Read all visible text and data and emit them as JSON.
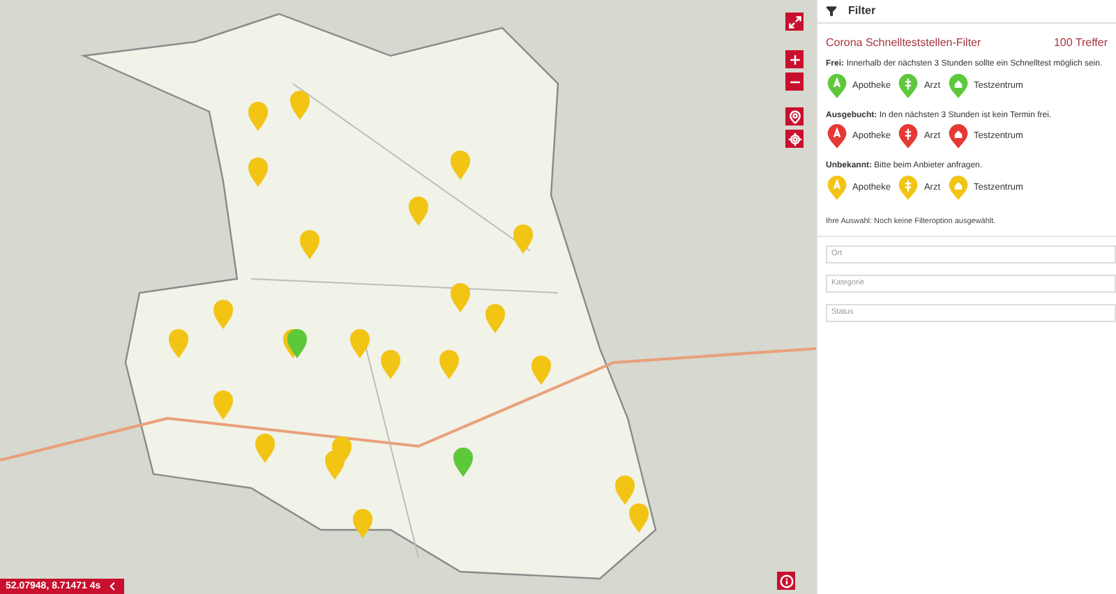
{
  "map": {
    "coordinates": "52.07948, 8.71471 4s"
  },
  "panel": {
    "header": "Filter",
    "title": "Corona Schnellteststellen-Filter",
    "count": "100 Treffer",
    "legend": [
      {
        "label": "Frei:",
        "text": "Innerhalb der nächsten 3 Stunden sollte ein Schnelltest möglich sein.",
        "color": "#5cc83a",
        "items": [
          {
            "kind": "pharmacy",
            "label": "Apotheke"
          },
          {
            "kind": "doctor",
            "label": "Arzt"
          },
          {
            "kind": "center",
            "label": "Testzentrum"
          }
        ]
      },
      {
        "label": "Ausgebucht:",
        "text": "In den nächsten 3 Stunden ist kein Termin frei.",
        "color": "#e53935",
        "items": [
          {
            "kind": "pharmacy",
            "label": "Apotheke"
          },
          {
            "kind": "doctor",
            "label": "Arzt"
          },
          {
            "kind": "center",
            "label": "Testzentrum"
          }
        ]
      },
      {
        "label": "Unbekannt:",
        "text": "Bitte beim Anbieter anfragen.",
        "color": "#f2c414",
        "items": [
          {
            "kind": "pharmacy",
            "label": "Apotheke"
          },
          {
            "kind": "doctor",
            "label": "Arzt"
          },
          {
            "kind": "center",
            "label": "Testzentrum"
          }
        ]
      }
    ],
    "selection": "Ihre Auswahl: Noch keine Filteroption ausgewählt.",
    "fields": [
      {
        "placeholder": "Ort"
      },
      {
        "placeholder": "Kategorie"
      },
      {
        "placeholder": "Status"
      }
    ]
  }
}
